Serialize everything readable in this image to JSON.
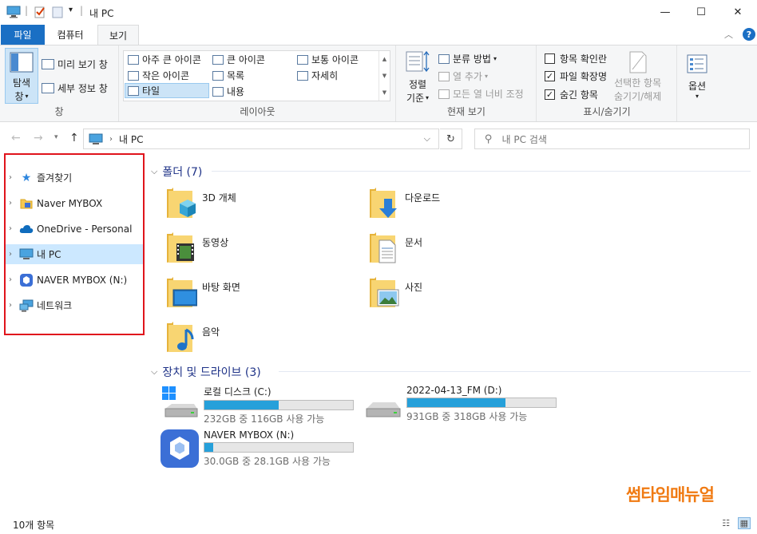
{
  "window": {
    "title": "내 PC",
    "minimize": "—",
    "maximize": "☐",
    "close": "✕"
  },
  "qat": {
    "separator": "|",
    "dropdown": "▾"
  },
  "tabs": {
    "file": "파일",
    "computer": "컴퓨터",
    "view": "보기",
    "collapse": "︿",
    "help": "?"
  },
  "ribbon": {
    "pane_group": {
      "navpane_line1": "탐색",
      "navpane_line2": "창",
      "preview": "미리 보기 창",
      "details": "세부 정보 창",
      "label": "창"
    },
    "layout_group": {
      "items": [
        "아주 큰 아이콘",
        "큰 아이콘",
        "보통 아이콘",
        "작은 아이콘",
        "목록",
        "자세히",
        "타일",
        "내용"
      ],
      "label": "레이아웃"
    },
    "current_view_group": {
      "sort_line1": "정렬",
      "sort_line2": "기준",
      "group_by": "분류 방법",
      "add_columns": "열 추가",
      "size_all_columns": "모든 열 너비 조정",
      "label": "현재 보기"
    },
    "show_hide_group": {
      "item_checkboxes": "항목 확인란",
      "file_extensions": "파일 확장명",
      "hidden_items": "숨긴 항목",
      "hide_selected_line1": "선택한 항목",
      "hide_selected_line2": "숨기기/해제",
      "label": "표시/숨기기"
    },
    "options": "옵션"
  },
  "address": {
    "path": "내 PC",
    "search_placeholder": "내 PC 검색"
  },
  "navpane": {
    "items": [
      "즐겨찾기",
      "Naver MYBOX",
      "OneDrive - Personal",
      "내 PC",
      "NAVER MYBOX (N:)",
      "네트워크"
    ]
  },
  "content": {
    "folders_header": "폴더 (7)",
    "folders": [
      "3D 개체",
      "다운로드",
      "동영상",
      "문서",
      "바탕 화면",
      "사진",
      "음악"
    ],
    "drives_header": "장치 및 드라이브 (3)",
    "drives": [
      {
        "name": "로컬 디스크 (C:)",
        "space": "232GB 중 116GB 사용 가능",
        "used": 0.5
      },
      {
        "name": "2022-04-13_FM (D:)",
        "space": "931GB 중 318GB 사용 가능",
        "used": 0.66
      },
      {
        "name": "NAVER MYBOX (N:)",
        "space": "30.0GB 중 28.1GB 사용 가능",
        "used": 0.06
      }
    ]
  },
  "status": {
    "count": "10개 항목"
  },
  "watermark": "썸타임매뉴얼",
  "colors": {
    "accent": "#1a6fc4",
    "drive_fill": "#26a0da",
    "highlight": "#e0141c",
    "watermark": "#f07a12"
  }
}
